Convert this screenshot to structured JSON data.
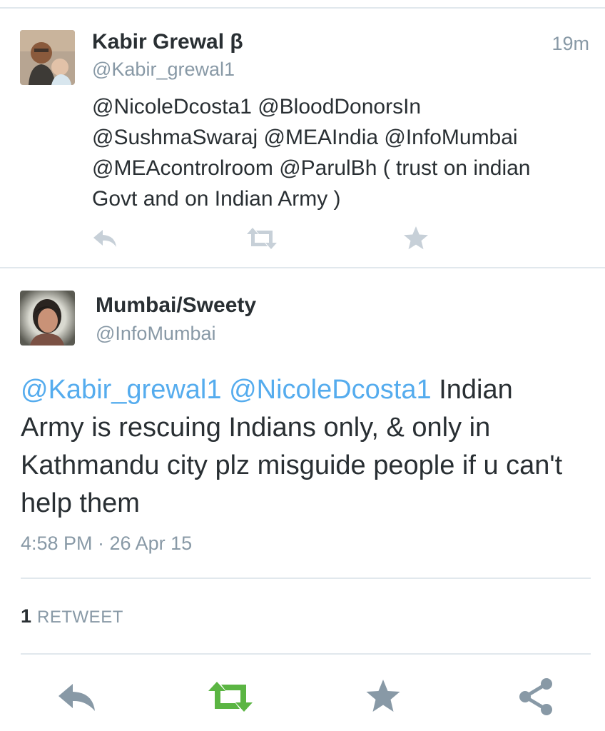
{
  "reply_tweet": {
    "name": "Kabir Grewal β",
    "handle": "@Kabir_grewal1",
    "time": "19m",
    "text_lines": [
      "@NicoleDcosta1 @BloodDonorsIn",
      "@SushmaSwaraj @MEAIndia @InfoMumbai",
      "@MEAcontrolroom @ParulBh ( trust on indian",
      "Govt and on Indian Army )"
    ],
    "actions": [
      "reply-icon",
      "retweet-icon",
      "favorite-icon"
    ]
  },
  "main_tweet": {
    "name": "Mumbai/Sweety",
    "handle": "@InfoMumbai",
    "mention_1": "@Kabir_grewal1",
    "mention_2": "@NicoleDcosta1",
    "line1_rest": " Indian",
    "text_lines": [
      "Army is rescuing Indians only, & only in",
      "Kathmandu city plz misguide people if u can't",
      "help them"
    ],
    "timestamp": "4:58 PM · 26 Apr 15",
    "retweet_count": "1",
    "retweet_label": "RETWEET",
    "actions": [
      "reply-icon",
      "retweet-icon",
      "favorite-icon",
      "share-icon"
    ]
  },
  "colors": {
    "text": "#292f33",
    "muted": "#8899a6",
    "link": "#55acee",
    "retweet_active": "#5bb543",
    "icon_gray": "#8899a6",
    "icon_light": "#c7d0d8"
  }
}
